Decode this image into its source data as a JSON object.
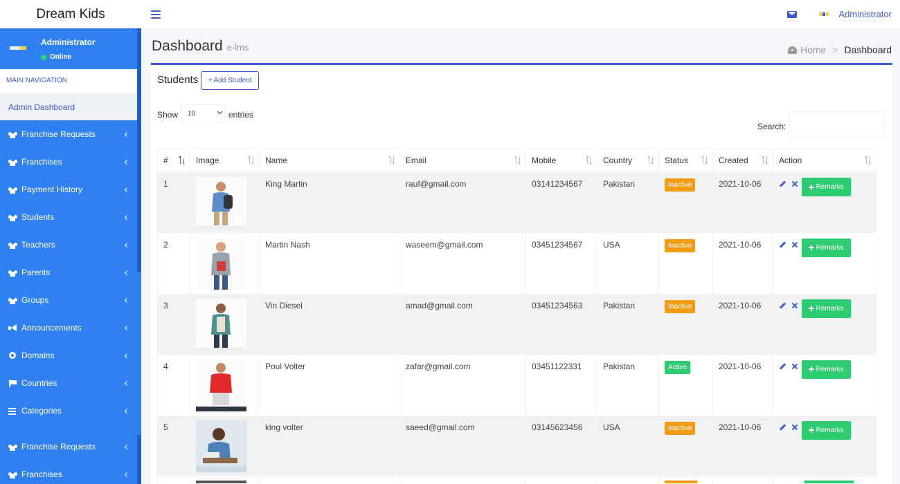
{
  "app": {
    "title": "Dream Kids",
    "user": "Administrator"
  },
  "sidebar": {
    "user_name": "Administrator",
    "user_status": "Online",
    "nav_header": "MAIN NAVIGATION",
    "dashboard": "Admin Dashboard",
    "items": [
      {
        "label": "Franchise Requests",
        "icon": "users-icon"
      },
      {
        "label": "Franchises",
        "icon": "users-icon"
      },
      {
        "label": "Payment History",
        "icon": "users-icon"
      },
      {
        "label": "Students",
        "icon": "users-icon"
      },
      {
        "label": "Teachers",
        "icon": "users-icon"
      },
      {
        "label": "Parents",
        "icon": "users-icon"
      },
      {
        "label": "Groups",
        "icon": "users-icon"
      },
      {
        "label": "Announcements",
        "icon": "bullhorn-icon"
      },
      {
        "label": "Domains",
        "icon": "globe-icon"
      },
      {
        "label": "Countries",
        "icon": "flag-icon"
      },
      {
        "label": "Categories",
        "icon": "bars-icon"
      }
    ],
    "items_repeat": [
      {
        "label": "Franchise Requests",
        "icon": "users-icon"
      },
      {
        "label": "Franchises",
        "icon": "users-icon"
      }
    ]
  },
  "page": {
    "title": "Dashboard",
    "subtitle": "e-lms",
    "breadcrumb_home": "Home",
    "breadcrumb_current": "Dashboard"
  },
  "box": {
    "title": "Students",
    "add_label": "+ Add Student",
    "show_label": "Show",
    "entries_value": "10",
    "entries_label": "entries",
    "search_label": "Search:",
    "search_value": ""
  },
  "table": {
    "columns": [
      "#",
      "Image",
      "Name",
      "Email",
      "Mobile",
      "Country",
      "Status",
      "Created",
      "Action"
    ],
    "remarks_label": "Remarks",
    "rows": [
      {
        "id": "1",
        "name": "King Martin",
        "email": "rauf@gmail.com",
        "mobile": "03141234567",
        "country": "Pakistan",
        "status": "Inactive",
        "created": "2021-10-06"
      },
      {
        "id": "2",
        "name": "Martin Nash",
        "email": "waseem@gmail.com",
        "mobile": "03451234567",
        "country": "USA",
        "status": "Inactive",
        "created": "2021-10-06"
      },
      {
        "id": "3",
        "name": "Vin Diesel",
        "email": "amad@gmail.com",
        "mobile": "03451234563",
        "country": "Pakistan",
        "status": "Inactive",
        "created": "2021-10-06"
      },
      {
        "id": "4",
        "name": "Poul Volter",
        "email": "zafar@gmail.com",
        "mobile": "03451122331",
        "country": "Pakistan",
        "status": "Active",
        "created": "2021-10-06"
      },
      {
        "id": "5",
        "name": "king volter",
        "email": "saeed@gmail.com",
        "mobile": "03145623456",
        "country": "USA",
        "status": "Inactive",
        "created": "2021-10-06"
      }
    ]
  },
  "colors": {
    "primary": "#3c5bcf",
    "sidebar": "#2f80f0",
    "inactive": "#f39c12",
    "active": "#2ecc71"
  }
}
